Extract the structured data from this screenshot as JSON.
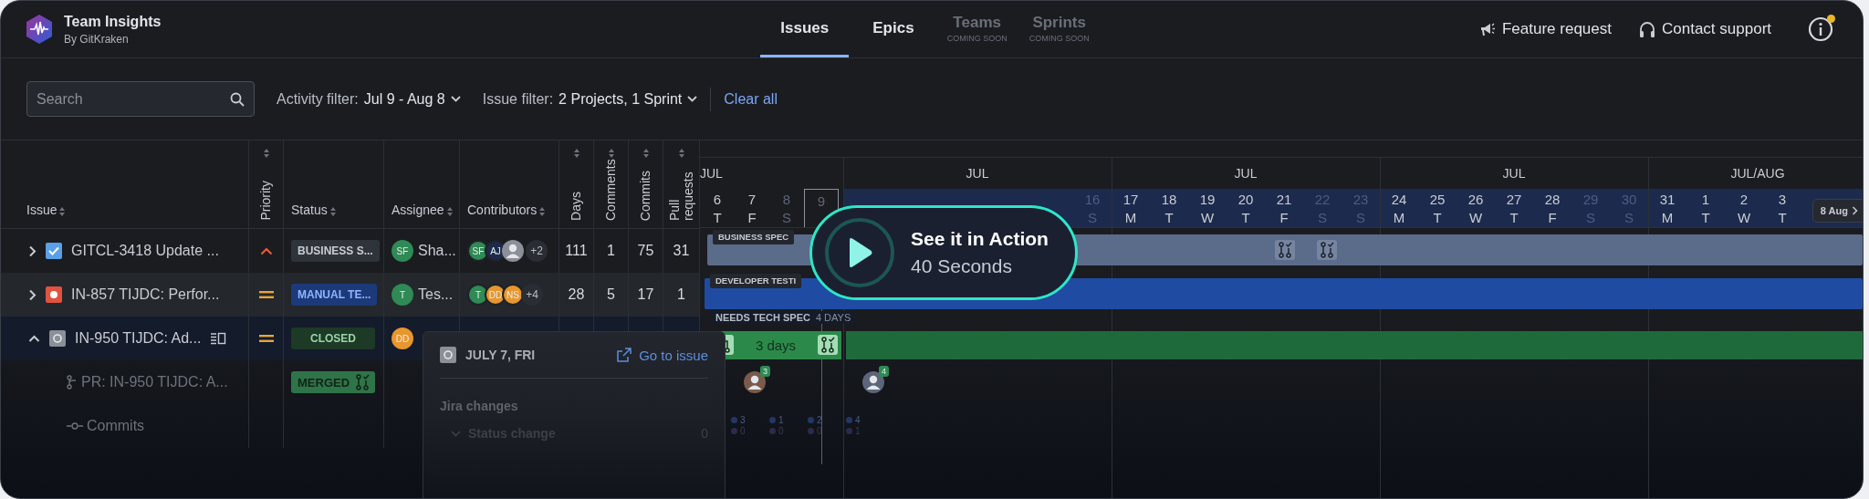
{
  "app": {
    "title": "Team Insights",
    "subtitle": "By GitKraken"
  },
  "tabs": [
    {
      "label": "Issues",
      "selected": true,
      "disabled": false
    },
    {
      "label": "Epics",
      "selected": false,
      "disabled": false
    },
    {
      "label": "Teams",
      "note": "COMING SOON",
      "selected": false,
      "disabled": true
    },
    {
      "label": "Sprints",
      "note": "COMING SOON",
      "selected": false,
      "disabled": true
    }
  ],
  "header_actions": [
    {
      "kind": "megaphone",
      "label": "Feature request"
    },
    {
      "kind": "headset",
      "label": "Contact support"
    }
  ],
  "info_button": {
    "notification": true
  },
  "filters": {
    "search": {
      "placeholder": "Search"
    },
    "activity": {
      "label": "Activity filter:",
      "value": "Jul 9 - Aug 8"
    },
    "issue": {
      "label": "Issue filter:",
      "value": "2 Projects, 1 Sprint"
    },
    "clear": "Clear all"
  },
  "table": {
    "columns": [
      {
        "label": "Issue",
        "kind": "horizontal"
      },
      {
        "label": "Priority",
        "kind": "vertical"
      },
      {
        "label": "Status",
        "kind": "horizontal"
      },
      {
        "label": "Assignee",
        "kind": "horizontal"
      },
      {
        "label": "Contributors",
        "kind": "horizontal"
      },
      {
        "label": "Days",
        "kind": "vertical"
      },
      {
        "label": "Comments",
        "kind": "vertical"
      },
      {
        "label": "Commits",
        "kind": "vertical"
      },
      {
        "label": "Pull requests",
        "kind": "vertical"
      }
    ],
    "rows": [
      {
        "kind": "issue",
        "expanded": false,
        "issue_type": {
          "kind": "task"
        },
        "title": "GITCL-3418 Update ...",
        "priority": {
          "kind": "high"
        },
        "status": {
          "kind": "neutral",
          "label": "BUSINESS S..."
        },
        "assignee": {
          "initials": "SF",
          "name": "Sha...",
          "color": "#2f8a55"
        },
        "contributors": [
          {
            "kind": "initials",
            "initials": "SF",
            "color": "#2f8a55"
          },
          {
            "kind": "initials",
            "initials": "AJ",
            "color": "#1d2a4a"
          },
          {
            "kind": "silhouette"
          }
        ],
        "more": "+2",
        "stats": [
          "111",
          "1",
          "75",
          "31"
        ]
      },
      {
        "kind": "issue",
        "expanded": false,
        "issue_type": {
          "kind": "bug"
        },
        "title": "IN-857 TIJDC: Perfor...",
        "priority": {
          "kind": "medium"
        },
        "status": {
          "kind": "progress",
          "label": "MANUAL TE..."
        },
        "assignee": {
          "initials": "T",
          "name": "Tes...",
          "color": "#2f8a55"
        },
        "contributors": [
          {
            "kind": "initials",
            "initials": "T",
            "color": "#2f8a55"
          },
          {
            "kind": "initials",
            "initials": "DD",
            "color": "#e8962e"
          },
          {
            "kind": "initials",
            "initials": "NS",
            "color": "#e8962e"
          }
        ],
        "more": "+4",
        "stats": [
          "28",
          "5",
          "17",
          "1"
        ]
      },
      {
        "kind": "issue",
        "expanded": true,
        "issue_type": {
          "kind": "other"
        },
        "title": "IN-950 TIJDC: Ad...",
        "details_icon": true,
        "priority": {
          "kind": "medium"
        },
        "status": {
          "kind": "done",
          "label": "CLOSED"
        },
        "assignee": {
          "initials": "DD",
          "color": "#e8962e"
        }
      },
      {
        "kind": "pr",
        "title": "PR: IN-950 TIJDC: A...",
        "status": {
          "kind": "merged",
          "label": "MERGED"
        }
      },
      {
        "kind": "commits",
        "title": "Commits"
      }
    ]
  },
  "timeline": {
    "segments": [
      {
        "month": "JUL",
        "days": [
          {
            "date": "6",
            "weekday": "T",
            "weekend": false,
            "in_range": false,
            "today": false
          },
          {
            "date": "7",
            "weekday": "F",
            "weekend": false,
            "in_range": false,
            "today": false
          },
          {
            "date": "8",
            "weekday": "S",
            "weekend": true,
            "in_range": false,
            "today": false
          },
          {
            "date": "9",
            "weekend": true,
            "in_range": false,
            "today": true
          }
        ]
      },
      {
        "month": "JUL",
        "days": [
          {
            "date": "16",
            "weekday": "S",
            "weekend": true,
            "in_range": true,
            "today": false
          }
        ]
      },
      {
        "month": "JUL",
        "days": [
          {
            "date": "17",
            "weekday": "M",
            "weekend": false,
            "in_range": true,
            "today": false
          },
          {
            "date": "18",
            "weekday": "T",
            "weekend": false,
            "in_range": true,
            "today": false
          },
          {
            "date": "19",
            "weekday": "W",
            "weekend": false,
            "in_range": true,
            "today": false
          },
          {
            "date": "20",
            "weekday": "T",
            "weekend": false,
            "in_range": true,
            "today": false
          },
          {
            "date": "21",
            "weekday": "F",
            "weekend": false,
            "in_range": true,
            "today": false
          },
          {
            "date": "22",
            "weekday": "S",
            "weekend": true,
            "in_range": true,
            "today": false
          },
          {
            "date": "23",
            "weekday": "S",
            "weekend": true,
            "in_range": true,
            "today": false
          }
        ]
      },
      {
        "month": "JUL",
        "days": [
          {
            "date": "24",
            "weekday": "M",
            "weekend": false,
            "in_range": true,
            "today": false
          },
          {
            "date": "25",
            "weekday": "T",
            "weekend": false,
            "in_range": true,
            "today": false
          },
          {
            "date": "26",
            "weekday": "W",
            "weekend": false,
            "in_range": true,
            "today": false
          },
          {
            "date": "27",
            "weekday": "T",
            "weekend": false,
            "in_range": true,
            "today": false
          },
          {
            "date": "28",
            "weekday": "F",
            "weekend": false,
            "in_range": true,
            "today": false
          },
          {
            "date": "29",
            "weekday": "S",
            "weekend": true,
            "in_range": true,
            "today": false
          },
          {
            "date": "30",
            "weekday": "S",
            "weekend": true,
            "in_range": true,
            "today": false
          }
        ]
      },
      {
        "month": "JUL/AUG",
        "days": [
          {
            "date": "31",
            "weekday": "M",
            "weekend": false,
            "in_range": true,
            "today": false
          },
          {
            "date": "1",
            "weekday": "T",
            "weekend": false,
            "in_range": true,
            "today": false
          },
          {
            "date": "2",
            "weekday": "W",
            "weekend": false,
            "in_range": true,
            "today": false
          },
          {
            "date": "3",
            "weekday": "T",
            "weekend": false,
            "in_range": true,
            "today": false
          }
        ]
      }
    ],
    "jump_button": "8 Aug",
    "lanes": [
      {
        "kind": "bar",
        "label": "BUSINESS SPEC",
        "color": "#5b6b8a",
        "markers": [
          {
            "kind": "merged"
          },
          {
            "kind": "merged"
          }
        ]
      },
      {
        "kind": "bar",
        "label": "DEVELOPER TESTI",
        "color": "#1f4ba3"
      },
      {
        "kind": "split",
        "label": "NEEDS TECH SPEC",
        "duration": "4 DAYS",
        "segments": [
          {
            "color": "#2b8a4a",
            "label": "3 days"
          },
          {
            "color": "#1f6a3a"
          }
        ]
      },
      {
        "kind": "avatars",
        "avatars": [
          {
            "kind": "photo",
            "count": "3"
          },
          {
            "kind": "silhouette",
            "count": "4"
          }
        ]
      },
      {
        "kind": "counts",
        "counts": [
          {
            "first": "3",
            "second": "0"
          },
          {
            "first": "1",
            "second": "0"
          },
          {
            "first": "2",
            "second": "0"
          },
          {
            "first": "4",
            "second": "1"
          }
        ]
      }
    ]
  },
  "popup": {
    "date": "JULY 7, FRI",
    "link": "Go to issue",
    "section": "Jira changes",
    "items": [
      {
        "label": "Status change",
        "count": "0",
        "expanded": false
      }
    ]
  },
  "promo": {
    "title": "See it in Action",
    "subtitle": "40 Seconds"
  }
}
